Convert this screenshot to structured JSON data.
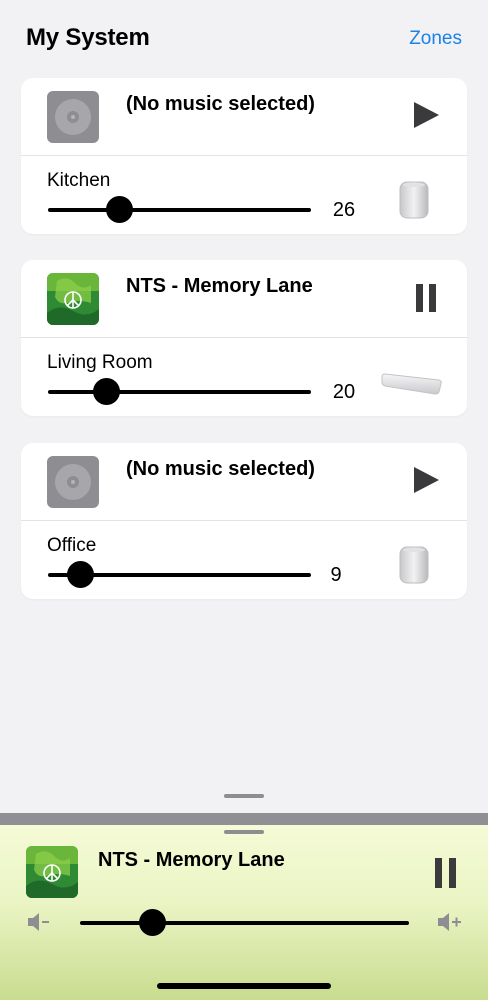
{
  "header": {
    "title": "My System",
    "zones_label": "Zones"
  },
  "cards": [
    {
      "track": "(No music selected)",
      "state": "play",
      "room": "Kitchen",
      "volume": "26",
      "volume_fraction": 0.27,
      "speaker": "speaker-one-icon",
      "art": "no-album-art"
    },
    {
      "track": "NTS - Memory Lane",
      "state": "pause",
      "room": "Living Room",
      "volume": "20",
      "volume_fraction": 0.22,
      "speaker": "soundbar-icon",
      "art": "album-art"
    },
    {
      "track": "(No music selected)",
      "state": "play",
      "room": "Office",
      "volume": "9",
      "volume_fraction": 0.12,
      "speaker": "speaker-one-icon",
      "art": "no-album-art"
    }
  ],
  "mini_player": {
    "track": "NTS - Memory Lane",
    "state": "pause",
    "volume_fraction": 0.22
  },
  "colors": {
    "accent": "#1a82e8",
    "background": "#f2f2f4",
    "card": "#ffffff",
    "mini_gradient_top": "#f5fbd6",
    "mini_gradient_bottom": "#c9dc8f"
  }
}
